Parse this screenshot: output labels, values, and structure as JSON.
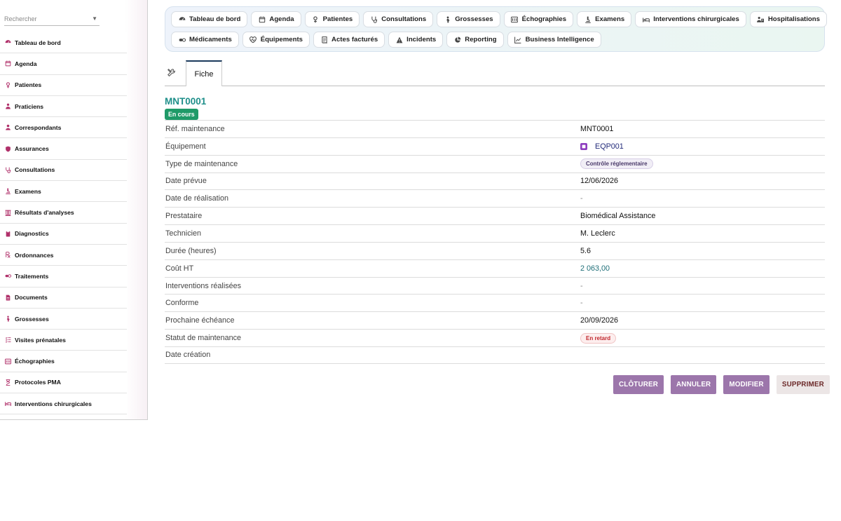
{
  "search": {
    "placeholder": "Rechercher"
  },
  "sidebar": {
    "items": [
      {
        "label": "Tableau de bord",
        "icon": "dashboard-icon"
      },
      {
        "label": "Agenda",
        "icon": "calendar-icon"
      },
      {
        "label": "Patientes",
        "icon": "female-icon"
      },
      {
        "label": "Praticiens",
        "icon": "doctor-icon"
      },
      {
        "label": "Correspondants",
        "icon": "user-icon"
      },
      {
        "label": "Assurances",
        "icon": "shield-icon"
      },
      {
        "label": "Consultations",
        "icon": "stethoscope-icon"
      },
      {
        "label": "Examens",
        "icon": "microscope-icon"
      },
      {
        "label": "Résultats d'analyses",
        "icon": "vials-icon"
      },
      {
        "label": "Diagnostics",
        "icon": "clipboard-icon"
      },
      {
        "label": "Ordonnances",
        "icon": "prescription-icon"
      },
      {
        "label": "Traitements",
        "icon": "pills-icon"
      },
      {
        "label": "Documents",
        "icon": "file-icon"
      },
      {
        "label": "Grossesses",
        "icon": "pregnant-icon"
      },
      {
        "label": "Visites prénatales",
        "icon": "checklist-icon"
      },
      {
        "label": "Échographies",
        "icon": "ultrasound-icon"
      },
      {
        "label": "Protocoles PMA",
        "icon": "hourglass-icon"
      },
      {
        "label": "Interventions chirurgicales",
        "icon": "bed-icon"
      }
    ]
  },
  "topnav": {
    "row1": [
      {
        "label": "Tableau de bord",
        "icon": "dashboard-icon"
      },
      {
        "label": "Agenda",
        "icon": "calendar-icon"
      },
      {
        "label": "Patientes",
        "icon": "female-icon"
      },
      {
        "label": "Consultations",
        "icon": "stethoscope-icon"
      },
      {
        "label": "Grossesses",
        "icon": "pregnant-icon"
      },
      {
        "label": "Échographies",
        "icon": "ultrasound-icon"
      },
      {
        "label": "Examens",
        "icon": "microscope-icon"
      },
      {
        "label": "Interventions chirurgicales",
        "icon": "bed-icon"
      },
      {
        "label": "Hospitalisations",
        "icon": "hospital-user-icon"
      }
    ],
    "row2": [
      {
        "label": "Médicaments",
        "icon": "pills-icon"
      },
      {
        "label": "Équipements",
        "icon": "heart-pulse-icon"
      },
      {
        "label": "Actes facturés",
        "icon": "invoice-icon"
      },
      {
        "label": "Incidents",
        "icon": "warning-icon"
      },
      {
        "label": "Reporting",
        "icon": "pie-chart-icon"
      },
      {
        "label": "Business Intelligence",
        "icon": "line-chart-icon"
      }
    ]
  },
  "tabs": {
    "fiche": "Fiche"
  },
  "record": {
    "title": "MNT0001",
    "status": "En cours",
    "fields": [
      {
        "label": "Réf. maintenance",
        "value": "MNT0001",
        "kind": "text"
      },
      {
        "label": "Équipement",
        "value": "EQP001",
        "kind": "link"
      },
      {
        "label": "Type de maintenance",
        "value": "Contrôle réglementaire",
        "kind": "chip-type"
      },
      {
        "label": "Date prévue",
        "value": "12/06/2026",
        "kind": "text"
      },
      {
        "label": "Date de réalisation",
        "value": "-",
        "kind": "muted"
      },
      {
        "label": "Prestataire",
        "value": "Biomédical Assistance",
        "kind": "text"
      },
      {
        "label": "Technicien",
        "value": "M. Leclerc",
        "kind": "text"
      },
      {
        "label": "Durée (heures)",
        "value": "5.6",
        "kind": "text"
      },
      {
        "label": "Coût HT",
        "value": "2 063,00",
        "kind": "teal"
      },
      {
        "label": "Interventions réalisées",
        "value": "-",
        "kind": "muted"
      },
      {
        "label": "Conforme",
        "value": "-",
        "kind": "muted"
      },
      {
        "label": "Prochaine échéance",
        "value": "20/09/2026",
        "kind": "text"
      },
      {
        "label": "Statut de maintenance",
        "value": "En retard",
        "kind": "chip-late"
      },
      {
        "label": "Date création",
        "value": "",
        "kind": "text"
      }
    ]
  },
  "actions": {
    "close": "CLÔTURER",
    "cancel": "ANNULER",
    "edit": "MODIFIER",
    "delete": "SUPPRIMER"
  },
  "colors": {
    "accent": "#9c76ab",
    "title": "#1f8f8a",
    "status_ok": "#1f9a68",
    "status_late": "#c0272d"
  }
}
